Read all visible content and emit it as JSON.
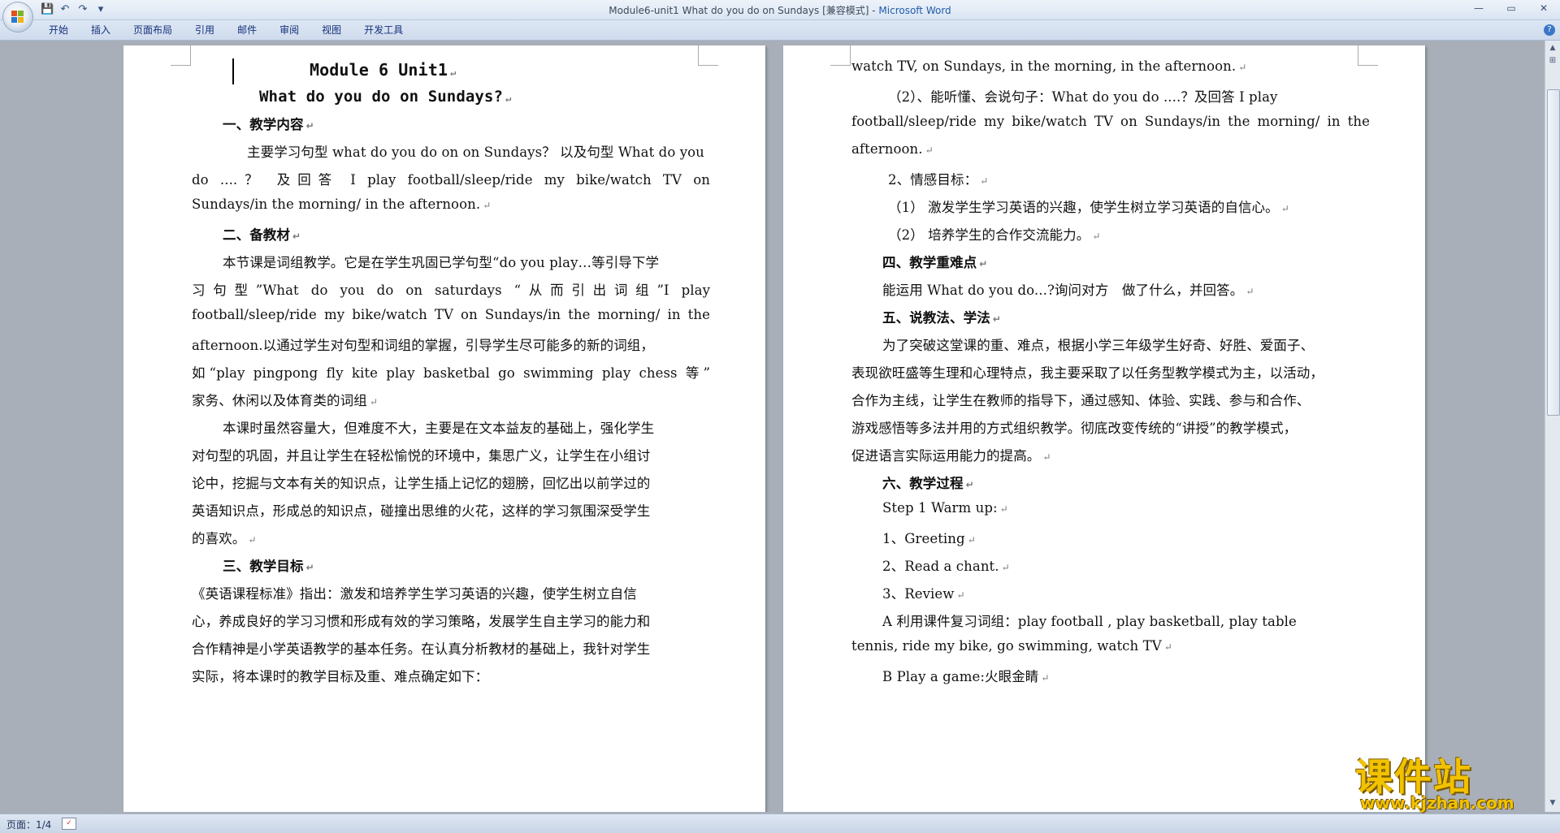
{
  "window": {
    "title": "Module6-unit1 What do you do on Sundays [兼容模式] - ",
    "app_name": "Microsoft Word",
    "controls": [
      "—",
      "▭",
      "✕"
    ]
  },
  "quick_access": {
    "save_icon": "💾",
    "undo_icon": "↶",
    "redo_icon": "↷",
    "customize_icon": "▾"
  },
  "ribbon": {
    "tabs": [
      "开始",
      "插入",
      "页面布局",
      "引用",
      "邮件",
      "审阅",
      "视图",
      "开发工具"
    ],
    "help_icon": "?"
  },
  "page1": {
    "lines": [
      "Module 6 Unit1",
      "What do you do on Sundays?",
      "一、教学内容",
      "主要学习句型 what do you do on on Sundays？ 以及句型 What do you",
      "do ....？ 及回答 I play football/sleep/ride my bike/watch TV on",
      "Sundays/in the morning/ in the afternoon.",
      "二、备教材",
      "本节课是词组教学。它是在学生巩固已学句型“do you play…等引导下学",
      "习句型”What do you do on saturdays “从而引出词组”I play",
      "football/sleep/ride my bike/watch TV on Sundays/in the morning/ in the",
      "afternoon.以通过学生对句型和词组的掌握，引导学生尽可能多的新的词组，",
      "如“play pingpong fly kite play basketbal go swimming play chess 等”",
      "家务、休闲以及体育类的词组",
      "本课时虽然容量大，但难度不大，主要是在文本益友的基础上，强化学生",
      "对句型的巩固，并且让学生在轻松愉悦的环境中，集思广义，让学生在小组讨",
      "论中，挖掘与文本有关的知识点，让学生插上记忆的翅膀，回忆出以前学过的",
      "英语知识点，形成总的知识点，碰撞出思维的火花，这样的学习氛围深受学生",
      "的喜欢。",
      "三、教学目标",
      "《英语课程标准》指出：激发和培养学生学习英语的兴趣，使学生树立自信",
      "心，养成良好的学习习惯和形成有效的学习策略，发展学生自主学习的能力和",
      "合作精神是小学英语教学的基本任务。在认真分析教材的基础上，我针对学生",
      "实际，将本课时的教学目标及重、难点确定如下："
    ]
  },
  "page2": {
    "lines": [
      "watch TV, on Sundays, in the morning, in the afternoon.",
      "（2）、能听懂、会说句子：What do you do ....？及回答 I play",
      "football/sleep/ride my bike/watch TV on Sundays/in the morning/ in the",
      "afternoon.",
      "2、情感目标：",
      "（1） 激发学生学习英语的兴趣，使学生树立学习英语的自信心。",
      "（2） 培养学生的合作交流能力。",
      "四、教学重难点",
      "能运用 What do you do...?询问对方　做了什么，并回答。",
      "五、说教法、学法",
      "为了突破这堂课的重、难点，根据小学三年级学生好奇、好胜、爱面子、",
      "表现欲旺盛等生理和心理特点，我主要采取了以任务型教学模式为主，以活动，",
      "合作为主线，让学生在教师的指导下，通过感知、体验、实践、参与和合作、",
      "游戏感悟等多法并用的方式组织教学。彻底改变传统的“讲授”的教学模式，",
      "促进语言实际运用能力的提高。",
      "六、教学过程",
      "Step 1 Warm up:",
      "1、Greeting",
      "2、Read a chant.",
      "3、Review",
      "A 利用课件复习词组：play football , play basketball, play table",
      "tennis, ride my bike, go swimming, watch TV",
      "B Play a game:火眼金睛"
    ]
  },
  "paragraph_mark": "↵",
  "status": {
    "page_count": "页面：1/4",
    "proofing_icon": "✓"
  },
  "watermark": {
    "cn": "课件站",
    "url": "www.kjzhan.com"
  },
  "scrollbar": {
    "up_icon": "▲",
    "down_icon": "▼",
    "ruler_icon": "⊞"
  }
}
